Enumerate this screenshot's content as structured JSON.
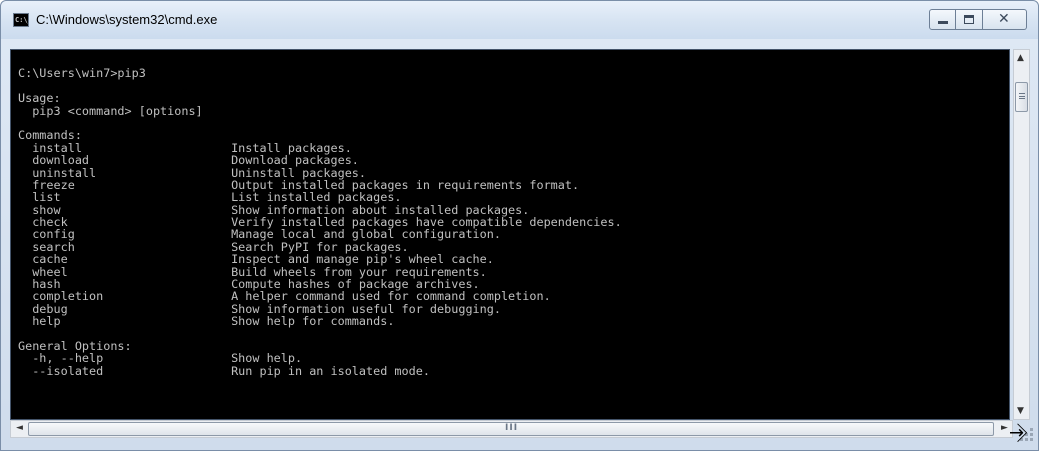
{
  "window": {
    "title": "C:\\Windows\\system32\\cmd.exe",
    "icon": "cmd-icon",
    "icon_label": "C:\\_"
  },
  "controls": {
    "minimize": "minimize-icon",
    "maximize": "maximize-icon",
    "close": "close-icon",
    "close_glyph": "✕"
  },
  "console": {
    "background": "#000000",
    "foreground": "#c0c0c0",
    "lines": [
      "",
      "C:\\Users\\win7>pip3",
      "",
      "Usage:",
      "  pip3 <command> [options]",
      "",
      "Commands:",
      "  install                     Install packages.",
      "  download                    Download packages.",
      "  uninstall                   Uninstall packages.",
      "  freeze                      Output installed packages in requirements format.",
      "  list                        List installed packages.",
      "  show                        Show information about installed packages.",
      "  check                       Verify installed packages have compatible dependencies.",
      "  config                      Manage local and global configuration.",
      "  search                      Search PyPI for packages.",
      "  cache                       Inspect and manage pip's wheel cache.",
      "  wheel                       Build wheels from your requirements.",
      "  hash                        Compute hashes of package archives.",
      "  completion                  A helper command used for command completion.",
      "  debug                       Show information useful for debugging.",
      "  help                        Show help for commands.",
      "",
      "General Options:",
      "  -h, --help                  Show help.",
      "  --isolated                  Run pip in an isolated mode."
    ]
  },
  "scrollbars": {
    "vertical_up": "▲",
    "vertical_down": "▼",
    "horizontal_left": "◄",
    "horizontal_right": "►",
    "horizontal_grip": "III"
  },
  "cursor": {
    "icon": "resize-cursor-icon",
    "glyph": "⇲"
  }
}
